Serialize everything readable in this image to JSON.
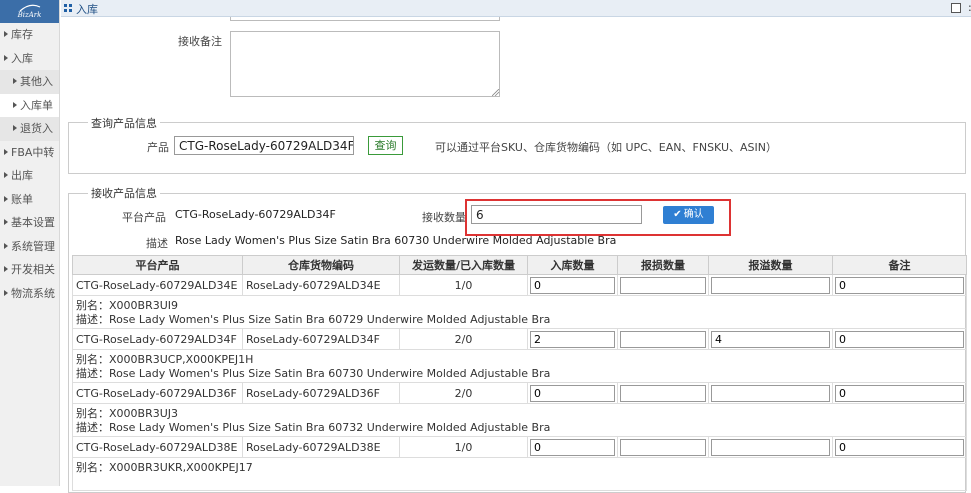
{
  "brand": {
    "logo_text": "BizArk"
  },
  "header": {
    "title": "入库",
    "more_label": ":"
  },
  "sidebar": {
    "items": [
      {
        "label": "库存",
        "level": 1
      },
      {
        "label": "入库",
        "level": 1
      },
      {
        "label": "其他入",
        "level": 2
      },
      {
        "label": "入库单",
        "level": 2,
        "active": true
      },
      {
        "label": "退货入",
        "level": 2
      },
      {
        "label": "FBA中转",
        "level": 1
      },
      {
        "label": "出库",
        "level": 1
      },
      {
        "label": "账单",
        "level": 1
      },
      {
        "label": "基本设置",
        "level": 1
      },
      {
        "label": "系统管理",
        "level": 1
      },
      {
        "label": "开发相关",
        "level": 1
      },
      {
        "label": "物流系统",
        "level": 1
      }
    ]
  },
  "form": {
    "remark_label": "接收备注",
    "remark_value": ""
  },
  "query": {
    "legend": "查询产品信息",
    "product_label": "产品",
    "product_value": "CTG-RoseLady-60729ALD34F",
    "query_button": "查询",
    "hint": "可以通过平台SKU、仓库货物编码（如 UPC、EAN、FNSKU、ASIN）"
  },
  "receive": {
    "legend": "接收产品信息",
    "platform_label": "平台产品",
    "platform_value": "CTG-RoseLady-60729ALD34F",
    "qty_label": "接收数量",
    "qty_value": "6",
    "confirm_button": "确认",
    "desc_label": "描述",
    "desc_value": "Rose Lady Women's Plus Size Satin Bra 60730 Underwire Molded Adjustable Bra"
  },
  "table": {
    "headers": [
      "平台产品",
      "仓库货物编码",
      "发运数量/已入库数量",
      "入库数量",
      "报损数量",
      "报溢数量",
      "备注"
    ],
    "rows": [
      {
        "platform": "CTG-RoseLady-60729ALD34E",
        "warehouse_code": "RoseLady-60729ALD34E",
        "ship_qty": "1/0",
        "in_qty": "0",
        "damage_qty": "",
        "overflow_qty": "",
        "note": "0",
        "alias": "别名：X000BR3UI9",
        "desc": "描述：Rose Lady Women's Plus Size Satin Bra 60729 Underwire Molded Adjustable Bra"
      },
      {
        "platform": "CTG-RoseLady-60729ALD34F",
        "warehouse_code": "RoseLady-60729ALD34F",
        "ship_qty": "2/0",
        "in_qty": "2",
        "damage_qty": "",
        "overflow_qty": "4",
        "note": "0",
        "alias": "别名：X000BR3UCP,X000KPEJ1H",
        "desc": "描述：Rose Lady Women's Plus Size Satin Bra 60730 Underwire Molded Adjustable Bra"
      },
      {
        "platform": "CTG-RoseLady-60729ALD36F",
        "warehouse_code": "RoseLady-60729ALD36F",
        "ship_qty": "2/0",
        "in_qty": "0",
        "damage_qty": "",
        "overflow_qty": "",
        "note": "0",
        "alias": "别名：X000BR3UJ3",
        "desc": "描述：Rose Lady Women's Plus Size Satin Bra 60732 Underwire Molded Adjustable Bra"
      },
      {
        "platform": "CTG-RoseLady-60729ALD38E",
        "warehouse_code": "RoseLady-60729ALD38E",
        "ship_qty": "1/0",
        "in_qty": "0",
        "damage_qty": "",
        "overflow_qty": "",
        "note": "0",
        "alias": "别名：X000BR3UKR,X000KPEJ17",
        "desc": ""
      }
    ]
  }
}
